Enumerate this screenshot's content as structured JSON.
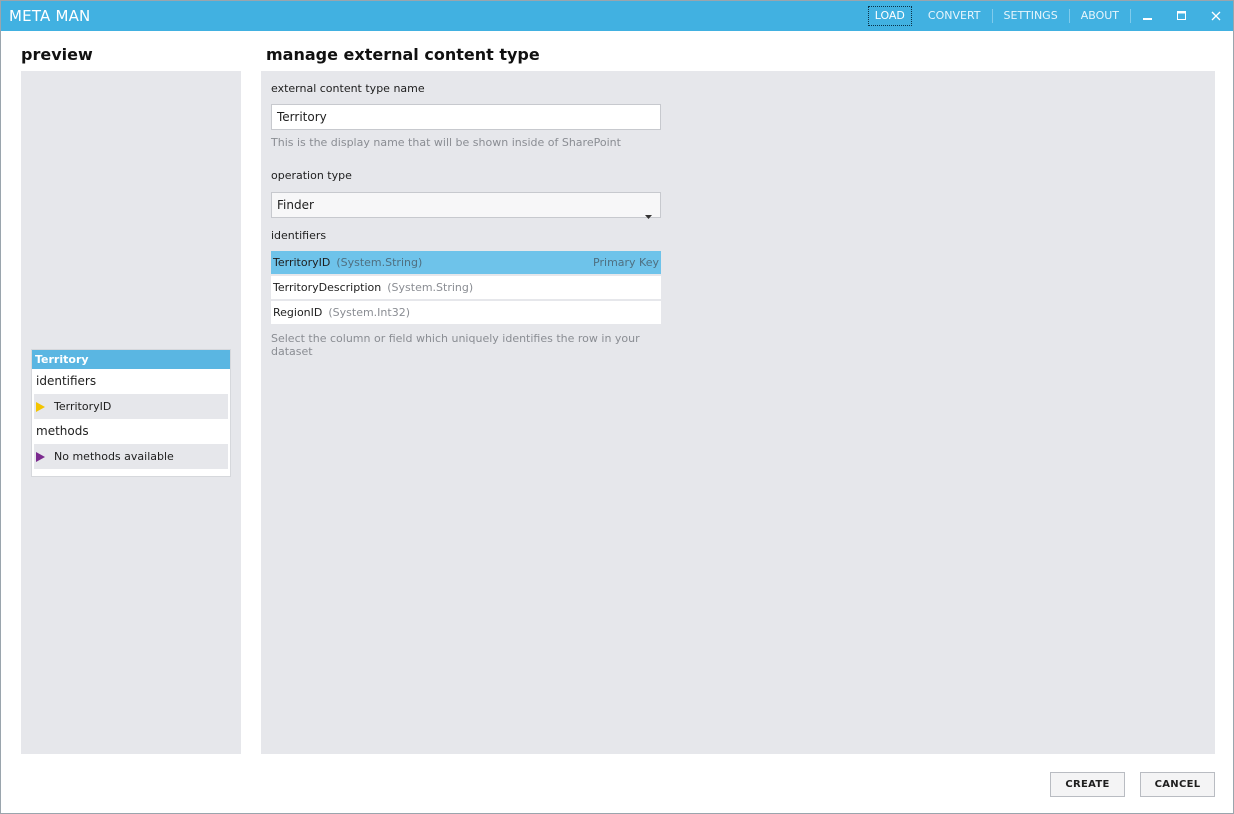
{
  "app": {
    "title": "META MAN"
  },
  "menu": {
    "load": "LOAD",
    "convert": "CONVERT",
    "settings": "SETTINGS",
    "about": "ABOUT"
  },
  "window_controls": {
    "icons": [
      "minimize-icon",
      "maximize-icon",
      "close-icon"
    ]
  },
  "preview": {
    "heading": "preview",
    "entity": {
      "title": "Territory",
      "identifiers_label": "identifiers",
      "identifiers": [
        {
          "label": "TerritoryID",
          "icon": "arrow-right-icon",
          "color": "#f3c400"
        }
      ],
      "methods_label": "methods",
      "methods": [
        {
          "label": "No methods available",
          "icon": "arrow-right-icon",
          "color": "#7b2a8e"
        }
      ]
    }
  },
  "manage": {
    "heading": "manage external content type",
    "name_label": "external content type name",
    "name_value": "Territory",
    "name_hint": "This is the display name that will be shown inside of SharePoint",
    "operation_label": "operation type",
    "operation_value": "Finder",
    "identifiers_label": "identifiers",
    "identifiers": [
      {
        "name": "TerritoryID",
        "type": "(System.String)",
        "badge": "Primary Key",
        "selected": true
      },
      {
        "name": "TerritoryDescription",
        "type": "(System.String)",
        "badge": "",
        "selected": false
      },
      {
        "name": "RegionID",
        "type": "(System.Int32)",
        "badge": "",
        "selected": false
      }
    ],
    "identifiers_hint": "Select the column or field which uniquely identifies the row in your dataset"
  },
  "footer": {
    "create_label": "CREATE",
    "cancel_label": "CANCEL"
  },
  "colors": {
    "titlebar": "#41b1e1",
    "selection": "#6ec3ea",
    "panel": "#e6e7eb"
  }
}
